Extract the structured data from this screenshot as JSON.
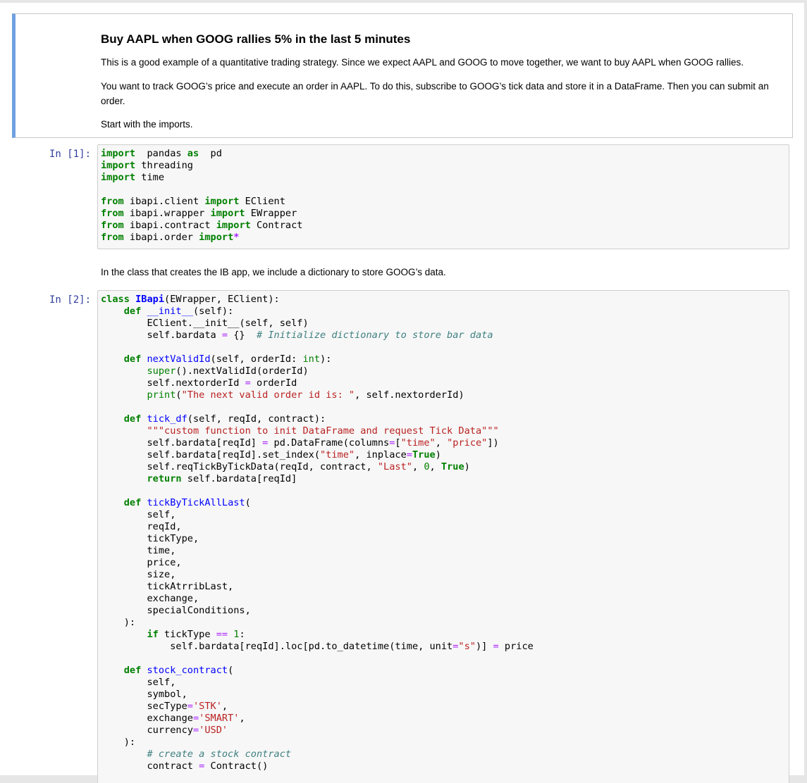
{
  "markdown_cell": {
    "title": "Buy AAPL when GOOG rallies 5% in the last 5 minutes",
    "paragraphs": [
      "This is a good example of a quantitative trading strategy. Since we expect AAPL and GOOG to move together, we want to buy AAPL when GOOG rallies.",
      "You want to track GOOG’s price and execute an order in AAPL. To do this, subscribe to GOOG’s tick data and store it in a DataFrame. Then you can submit an order.",
      "Start with the imports."
    ]
  },
  "cell1": {
    "prompt": "In [1]:",
    "lines": [
      [
        [
          "kw",
          "import"
        ],
        [
          "",
          "  pandas "
        ],
        [
          "kw",
          "as"
        ],
        [
          "",
          "  pd"
        ]
      ],
      [
        [
          "kw",
          "import"
        ],
        [
          "",
          " threading"
        ]
      ],
      [
        [
          "kw",
          "import"
        ],
        [
          "",
          " time"
        ]
      ],
      [],
      [
        [
          "kw",
          "from"
        ],
        [
          "",
          " ibapi.client "
        ],
        [
          "kw",
          "import"
        ],
        [
          "",
          " EClient"
        ]
      ],
      [
        [
          "kw",
          "from"
        ],
        [
          "",
          " ibapi.wrapper "
        ],
        [
          "kw",
          "import"
        ],
        [
          "",
          " EWrapper"
        ]
      ],
      [
        [
          "kw",
          "from"
        ],
        [
          "",
          " ibapi.contract "
        ],
        [
          "kw",
          "import"
        ],
        [
          "",
          " Contract"
        ]
      ],
      [
        [
          "kw",
          "from"
        ],
        [
          "",
          " ibapi.order "
        ],
        [
          "kw",
          "import"
        ],
        [
          " ",
          ""
        ],
        [
          "opb",
          "*"
        ]
      ]
    ]
  },
  "middle_text": "In the class that creates the IB app, we include a dictionary to store GOOG’s data.",
  "cell2": {
    "prompt": "In [2]:",
    "lines": [
      [
        [
          "kw",
          "class"
        ],
        [
          "",
          " "
        ],
        [
          "cls",
          "IBapi"
        ],
        [
          "",
          "(EWrapper, EClient):"
        ]
      ],
      [
        [
          "",
          "    "
        ],
        [
          "kw",
          "def"
        ],
        [
          "",
          " "
        ],
        [
          "fn",
          "__init__"
        ],
        [
          "",
          "(self):"
        ]
      ],
      [
        [
          "",
          "        EClient."
        ],
        [
          "",
          "__init__"
        ],
        [
          "",
          "(self, self)"
        ]
      ],
      [
        [
          "",
          "        self.bardata "
        ],
        [
          "op",
          "="
        ],
        [
          "",
          " {}  "
        ],
        [
          "cm",
          "# Initialize dictionary to store bar data"
        ]
      ],
      [],
      [
        [
          "",
          "    "
        ],
        [
          "kw",
          "def"
        ],
        [
          "",
          " "
        ],
        [
          "fn",
          "nextValidId"
        ],
        [
          "",
          "(self, orderId: "
        ],
        [
          "bi",
          "int"
        ],
        [
          "",
          "):"
        ]
      ],
      [
        [
          "",
          "        "
        ],
        [
          "bi",
          "super"
        ],
        [
          "",
          "().nextValidId(orderId)"
        ]
      ],
      [
        [
          "",
          "        self.nextorderId "
        ],
        [
          "op",
          "="
        ],
        [
          "",
          " orderId"
        ]
      ],
      [
        [
          "",
          "        "
        ],
        [
          "bi",
          "print"
        ],
        [
          "",
          "("
        ],
        [
          "st",
          "\"The next valid order id is: \""
        ],
        [
          "",
          ", self.nextorderId)"
        ]
      ],
      [],
      [
        [
          "",
          "    "
        ],
        [
          "kw",
          "def"
        ],
        [
          "",
          " "
        ],
        [
          "fn",
          "tick_df"
        ],
        [
          "",
          "(self, reqId, contract):"
        ]
      ],
      [
        [
          "",
          "        "
        ],
        [
          "st",
          "\"\"\"custom function to init DataFrame and request Tick Data\"\"\""
        ]
      ],
      [
        [
          "",
          "        self.bardata[reqId] "
        ],
        [
          "op",
          "="
        ],
        [
          "",
          " pd.DataFrame(columns"
        ],
        [
          "op",
          "="
        ],
        [
          "",
          "["
        ],
        [
          "st",
          "\"time\""
        ],
        [
          "",
          ", "
        ],
        [
          "st",
          "\"price\""
        ],
        [
          "",
          "])"
        ]
      ],
      [
        [
          "",
          "        self.bardata[reqId].set_index("
        ],
        [
          "st",
          "\"time\""
        ],
        [
          "",
          ", inplace"
        ],
        [
          "op",
          "="
        ],
        [
          "kw",
          "True"
        ],
        [
          "",
          ")"
        ]
      ],
      [
        [
          "",
          "        self.reqTickByTickData(reqId, contract, "
        ],
        [
          "st",
          "\"Last\""
        ],
        [
          "",
          ", "
        ],
        [
          "nu",
          "0"
        ],
        [
          "",
          ", "
        ],
        [
          "kw",
          "True"
        ],
        [
          "",
          ")"
        ]
      ],
      [
        [
          "",
          "        "
        ],
        [
          "kw",
          "return"
        ],
        [
          "",
          " self.bardata[reqId]"
        ]
      ],
      [],
      [
        [
          "",
          "    "
        ],
        [
          "kw",
          "def"
        ],
        [
          "",
          " "
        ],
        [
          "fn",
          "tickByTickAllLast"
        ],
        [
          "",
          "("
        ]
      ],
      [
        [
          "",
          "        self,"
        ]
      ],
      [
        [
          "",
          "        reqId,"
        ]
      ],
      [
        [
          "",
          "        tickType,"
        ]
      ],
      [
        [
          "",
          "        time,"
        ]
      ],
      [
        [
          "",
          "        price,"
        ]
      ],
      [
        [
          "",
          "        size,"
        ]
      ],
      [
        [
          "",
          "        tickAtrribLast,"
        ]
      ],
      [
        [
          "",
          "        exchange,"
        ]
      ],
      [
        [
          "",
          "        specialConditions,"
        ]
      ],
      [
        [
          "",
          "    ):"
        ]
      ],
      [
        [
          "",
          "        "
        ],
        [
          "kw",
          "if"
        ],
        [
          "",
          " tickType "
        ],
        [
          "op",
          "=="
        ],
        [
          "",
          " "
        ],
        [
          "nu",
          "1"
        ],
        [
          "",
          ":"
        ]
      ],
      [
        [
          "",
          "            self.bardata[reqId].loc[pd.to_datetime(time, unit"
        ],
        [
          "op",
          "="
        ],
        [
          "st",
          "\"s\""
        ],
        [
          "",
          ")] "
        ],
        [
          "op",
          "="
        ],
        [
          "",
          " price"
        ]
      ],
      [],
      [
        [
          "",
          "    "
        ],
        [
          "kw",
          "def"
        ],
        [
          "",
          " "
        ],
        [
          "fn",
          "stock_contract"
        ],
        [
          "",
          "("
        ]
      ],
      [
        [
          "",
          "        self,"
        ]
      ],
      [
        [
          "",
          "        symbol,"
        ]
      ],
      [
        [
          "",
          "        secType"
        ],
        [
          "op",
          "="
        ],
        [
          "st",
          "'STK'"
        ],
        [
          "",
          ","
        ]
      ],
      [
        [
          "",
          "        exchange"
        ],
        [
          "op",
          "="
        ],
        [
          "st",
          "'SMART'"
        ],
        [
          "",
          ","
        ]
      ],
      [
        [
          "",
          "        currency"
        ],
        [
          "op",
          "="
        ],
        [
          "st",
          "'USD'"
        ]
      ],
      [
        [
          "",
          "    ):"
        ]
      ],
      [
        [
          "",
          "        "
        ],
        [
          "cm",
          "# create a stock contract"
        ]
      ],
      [
        [
          "",
          "        contract "
        ],
        [
          "op",
          "="
        ],
        [
          "",
          " Contract()"
        ]
      ]
    ]
  }
}
